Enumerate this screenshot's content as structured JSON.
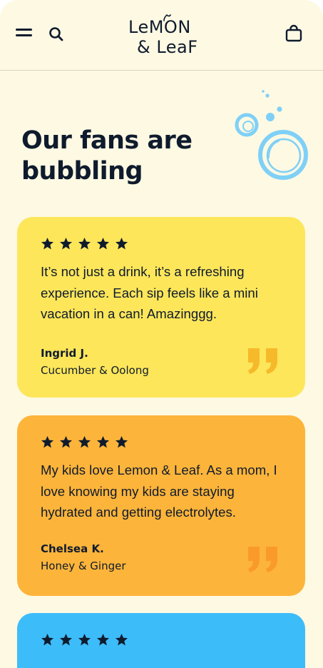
{
  "header": {
    "logo_line1": "LeMON",
    "logo_line2": "& LeaF"
  },
  "section": {
    "title": "Our fans are bubbling"
  },
  "reviews": [
    {
      "rating": 5,
      "quote": "It’s not just a drink, it’s a refreshing experience. Each sip feels like a mini vacation in a can! Amazinggg.",
      "name": "Ingrid J.",
      "flavor": "Cucumber & Oolong",
      "color": "#fde65a"
    },
    {
      "rating": 5,
      "quote": "My kids love Lemon & Leaf. As a mom, I love knowing my kids are staying hydrated and getting electrolytes.",
      "name": "Chelsea K.",
      "flavor": "Honey & Ginger",
      "color": "#fdb43a"
    },
    {
      "rating": 5,
      "color": "#3dbcfa"
    }
  ],
  "icons": {
    "menu": "menu-icon",
    "search": "search-icon",
    "cart": "bag-icon",
    "star": "star-icon",
    "quote": "quote-icon"
  },
  "colors": {
    "background": "#fdf9e3",
    "text": "#0f1b2d",
    "bubble": "#7fd0f7"
  }
}
